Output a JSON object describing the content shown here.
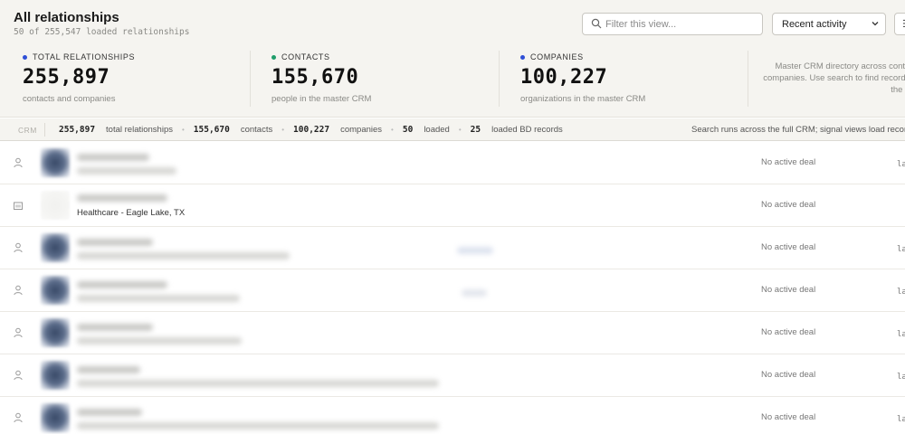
{
  "header": {
    "title": "All relationships",
    "subtitle": "50 of 255,547 loaded relationships",
    "filter_placeholder": "Filter this view...",
    "sort_value": "Recent activity"
  },
  "stats": [
    {
      "label": "TOTAL RELATIONSHIPS",
      "value": "255,897",
      "sub": "contacts and companies",
      "color": "#2f4fd6"
    },
    {
      "label": "CONTACTS",
      "value": "155,670",
      "sub": "people in the master CRM",
      "color": "#1f9d6a"
    },
    {
      "label": "COMPANIES",
      "value": "100,227",
      "sub": "organizations in the master CRM",
      "color": "#2f4fd6"
    }
  ],
  "directory_note": "Master CRM directory across contacts and companies. Use search to find records across the full view.",
  "summary": {
    "tag": "CRM",
    "items": [
      {
        "value": "255,897",
        "label": "total relationships"
      },
      {
        "value": "155,670",
        "label": "contacts"
      },
      {
        "value": "100,227",
        "label": "companies"
      },
      {
        "value": "50",
        "label": "loaded"
      },
      {
        "value": "25",
        "label": "loaded BD records"
      }
    ],
    "note": "Search runs across the full CRM; signal views load records i"
  },
  "rows": [
    {
      "type": "person-icon",
      "subtitle": "",
      "deal": "No active deal",
      "trailing": "la"
    },
    {
      "type": "building-icon",
      "subtitle": "Healthcare - Eagle Lake, TX",
      "deal": "No active deal",
      "trailing": ""
    },
    {
      "type": "person-icon",
      "subtitle": "",
      "deal": "No active deal",
      "trailing": "la"
    },
    {
      "type": "person-icon",
      "subtitle": "",
      "deal": "No active deal",
      "trailing": "la"
    },
    {
      "type": "person-icon",
      "subtitle": "",
      "deal": "No active deal",
      "trailing": "la"
    },
    {
      "type": "person-icon",
      "subtitle": "",
      "deal": "No active deal",
      "trailing": "la"
    },
    {
      "type": "person-icon",
      "subtitle": "",
      "deal": "No active deal",
      "trailing": "la"
    }
  ]
}
